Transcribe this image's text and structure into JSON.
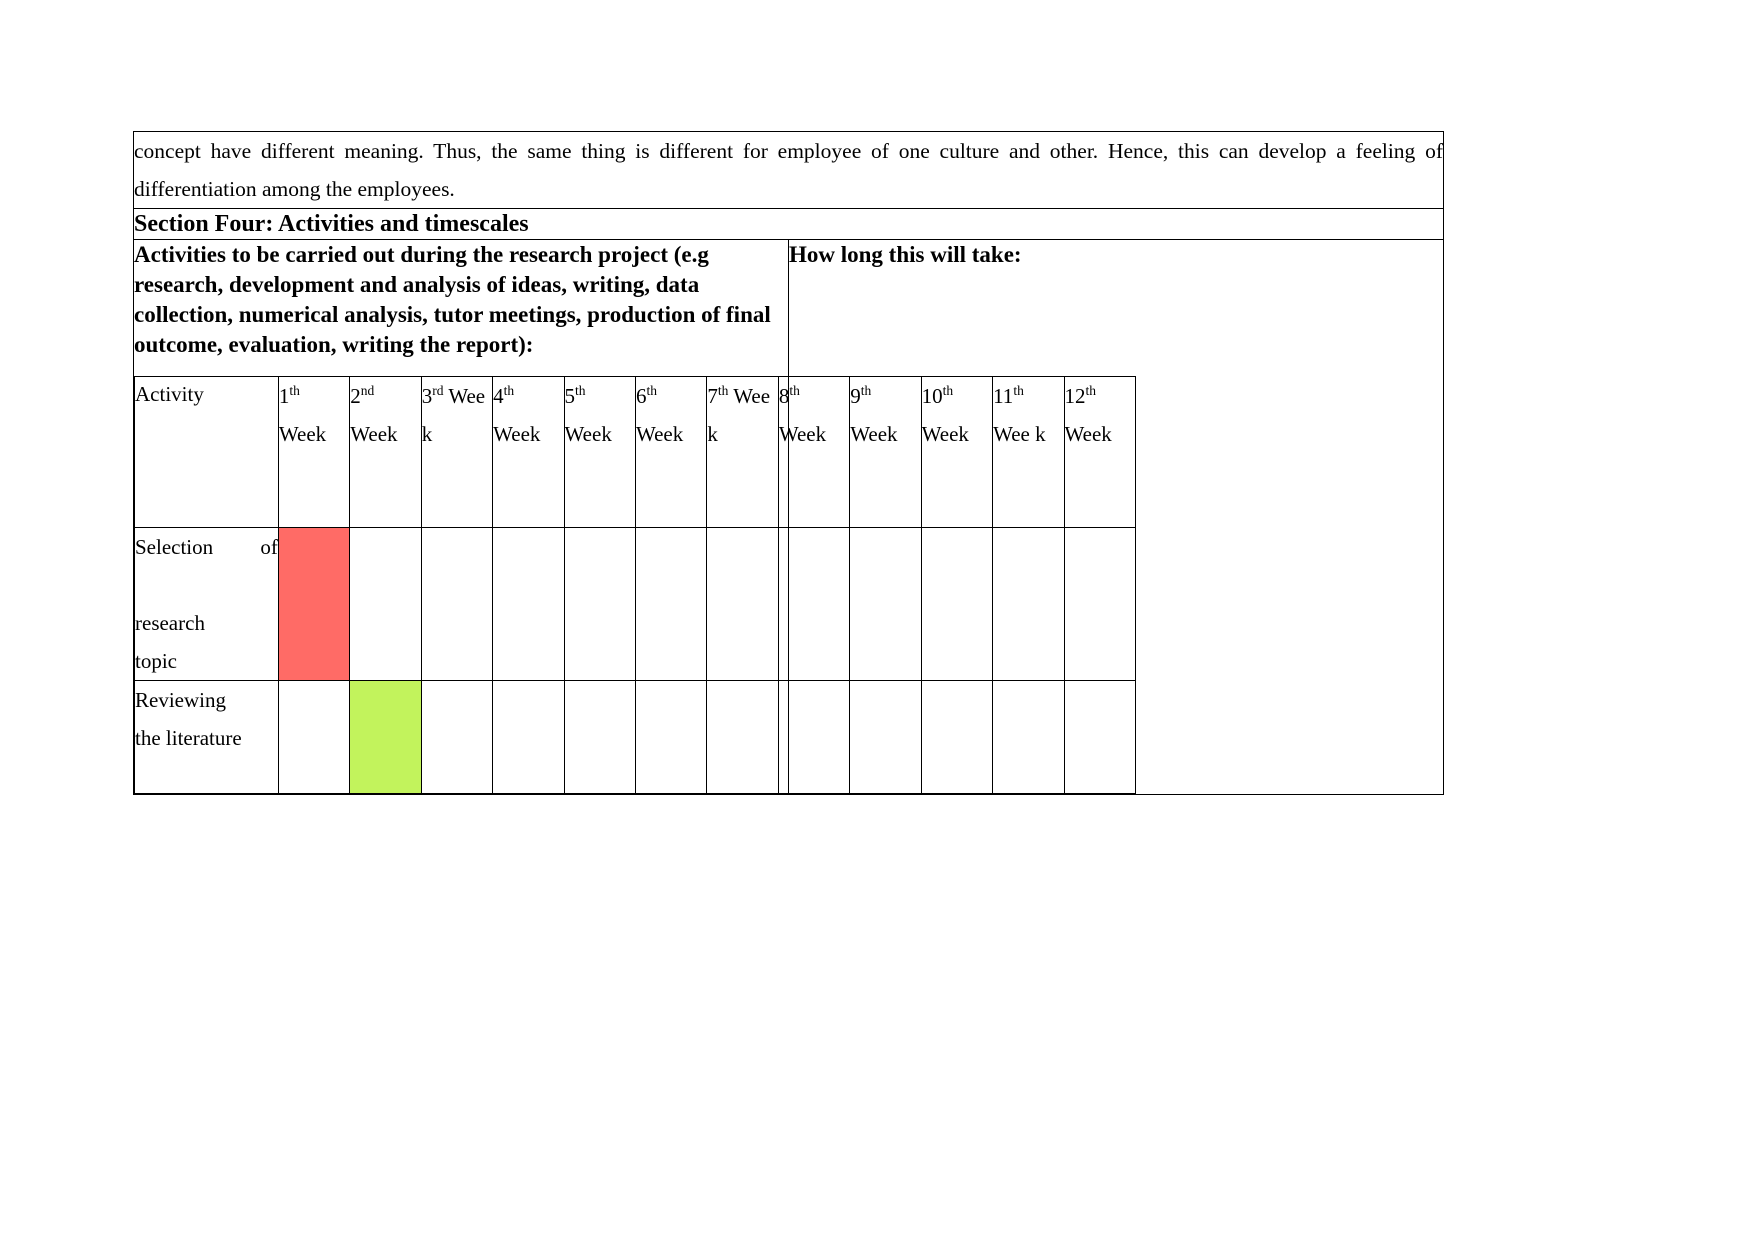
{
  "document": {
    "paragraph": "concept have different meaning. Thus, the same thing is different for employee of one culture and other. Hence, this can develop a feeling of differentiation among the employees.",
    "section_title": "Section Four: Activities and timescales",
    "activities_prompt": "Activities to be carried out during the research project (e.g research, development and analysis of ideas, writing, data collection, numerical analysis, tutor meetings, production of final outcome, evaluation, writing the report):",
    "how_long_label": "How long this will take:"
  },
  "gantt": {
    "activity_header": "Activity",
    "week_headers": [
      {
        "number": "1",
        "ordinal": "th",
        "word": "Week"
      },
      {
        "number": "2",
        "ordinal": "nd",
        "word": "Week"
      },
      {
        "number": "3",
        "ordinal": "rd",
        "word": "Wee k"
      },
      {
        "number": "4",
        "ordinal": "th",
        "word": "Week"
      },
      {
        "number": "5",
        "ordinal": "th",
        "word": "Week"
      },
      {
        "number": "6",
        "ordinal": "th",
        "word": "Week"
      },
      {
        "number": "7",
        "ordinal": "th",
        "word": "Wee k"
      },
      {
        "number": "8",
        "ordinal": "th",
        "word": "Week"
      },
      {
        "number": "9",
        "ordinal": "th",
        "word": "Week"
      },
      {
        "number": "10",
        "ordinal": "th",
        "word": "Week"
      },
      {
        "number": "11",
        "ordinal": "th",
        "word": "Wee k"
      },
      {
        "number": "12",
        "ordinal": "th",
        "word": "Week"
      }
    ],
    "rows": [
      {
        "label_line1": "Selection    of",
        "label_line2": "research",
        "label_line3": "topic",
        "fill_color": "#FF6B66",
        "cells": [
          true,
          false,
          false,
          false,
          false,
          false,
          false,
          false,
          false,
          false,
          false,
          false
        ]
      },
      {
        "label_line1": "Reviewing",
        "label_line2": "the literature",
        "label_line3": "",
        "fill_color": "#C2F35C",
        "cells": [
          false,
          true,
          false,
          false,
          false,
          false,
          false,
          false,
          false,
          false,
          false,
          false
        ]
      }
    ]
  }
}
